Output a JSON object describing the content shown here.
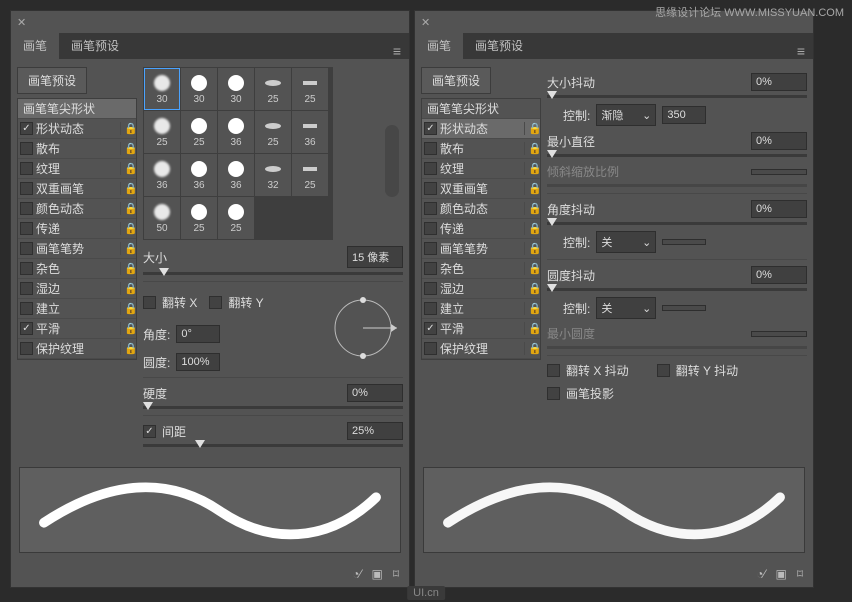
{
  "watermark": "思缘设计论坛 WWW.MISSYUAN.COM",
  "footer_logo": "UI.cn",
  "panel_left": {
    "tabs": [
      "画笔",
      "画笔预设"
    ],
    "preset_btn": "画笔预设",
    "tip_label": "画笔笔尖形状",
    "options": [
      {
        "label": "形状动态",
        "checked": true,
        "lock": true
      },
      {
        "label": "散布",
        "checked": false,
        "lock": true
      },
      {
        "label": "纹理",
        "checked": false,
        "lock": true
      },
      {
        "label": "双重画笔",
        "checked": false,
        "lock": true
      },
      {
        "label": "颜色动态",
        "checked": false,
        "lock": true
      },
      {
        "label": "传递",
        "checked": false,
        "lock": true
      },
      {
        "label": "画笔笔势",
        "checked": false,
        "lock": true
      },
      {
        "label": "杂色",
        "checked": false,
        "lock": true
      },
      {
        "label": "湿边",
        "checked": false,
        "lock": true
      },
      {
        "label": "建立",
        "checked": false,
        "lock": true
      },
      {
        "label": "平滑",
        "checked": true,
        "lock": true
      },
      {
        "label": "保护纹理",
        "checked": false,
        "lock": true
      }
    ],
    "thumbs": [
      30,
      30,
      30,
      25,
      25,
      25,
      25,
      36,
      25,
      36,
      36,
      36,
      36,
      32,
      25,
      50,
      25,
      25
    ],
    "size_label": "大小",
    "size_val": "15 像素",
    "flipx": "翻转 X",
    "flipy": "翻转 Y",
    "angle_label": "角度:",
    "angle_val": "0°",
    "round_label": "圆度:",
    "round_val": "100%",
    "hard_label": "硬度",
    "hard_val": "0%",
    "spacing_label": "间距",
    "spacing_val": "25%"
  },
  "panel_right": {
    "tabs": [
      "画笔",
      "画笔预设"
    ],
    "preset_btn": "画笔预设",
    "tip_label": "画笔笔尖形状",
    "options": [
      {
        "label": "形状动态",
        "checked": true,
        "lock": true
      },
      {
        "label": "散布",
        "checked": false,
        "lock": true
      },
      {
        "label": "纹理",
        "checked": false,
        "lock": true
      },
      {
        "label": "双重画笔",
        "checked": false,
        "lock": true
      },
      {
        "label": "颜色动态",
        "checked": false,
        "lock": true
      },
      {
        "label": "传递",
        "checked": false,
        "lock": true
      },
      {
        "label": "画笔笔势",
        "checked": false,
        "lock": true
      },
      {
        "label": "杂色",
        "checked": false,
        "lock": true
      },
      {
        "label": "湿边",
        "checked": false,
        "lock": true
      },
      {
        "label": "建立",
        "checked": false,
        "lock": true
      },
      {
        "label": "平滑",
        "checked": true,
        "lock": true
      },
      {
        "label": "保护纹理",
        "checked": false,
        "lock": true
      }
    ],
    "size_jitter_label": "大小抖动",
    "size_jitter_val": "0%",
    "ctrl1_label": "控制:",
    "ctrl1_sel": "渐隐",
    "ctrl1_val": "350",
    "mindiam_label": "最小直径",
    "mindiam_val": "0%",
    "tiltscale_label": "倾斜缩放比例",
    "angle_jitter_label": "角度抖动",
    "angle_jitter_val": "0%",
    "ctrl2_label": "控制:",
    "ctrl2_sel": "关",
    "round_jitter_label": "圆度抖动",
    "round_jitter_val": "0%",
    "ctrl3_label": "控制:",
    "ctrl3_sel": "关",
    "minround_label": "最小圆度",
    "flipx_jitter": "翻转 X 抖动",
    "flipy_jitter": "翻转 Y 抖动",
    "brush_proj": "画笔投影"
  }
}
